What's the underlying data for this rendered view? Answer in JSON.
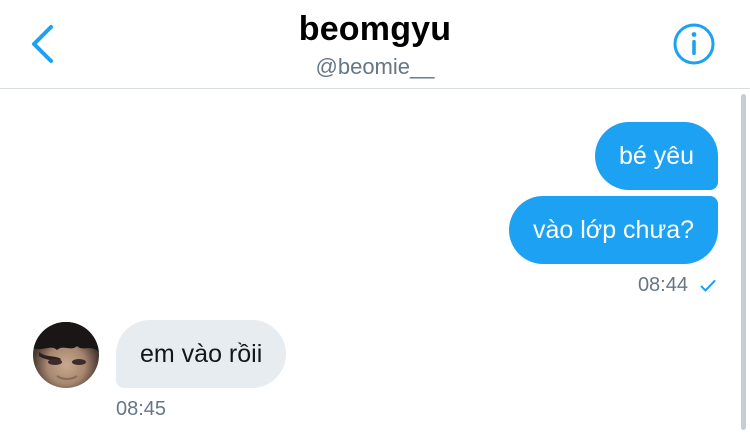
{
  "header": {
    "title": "beomgyu",
    "handle": "@beomie__",
    "back_icon": "chevron-left-icon",
    "info_icon": "info-circle-icon",
    "accent": "#1da1f2"
  },
  "messages": [
    {
      "direction": "outgoing",
      "text": "bé yêu"
    },
    {
      "direction": "outgoing",
      "text": "vào lớp chưa?"
    },
    {
      "direction": "incoming",
      "text": "em vào rồii"
    }
  ],
  "outgoing_meta": {
    "time": "08:44",
    "status_icon": "checkmark-icon"
  },
  "incoming_meta": {
    "time": "08:45"
  },
  "colors": {
    "outgoing_bubble": "#1da1f2",
    "incoming_bubble": "#e6ecf0",
    "meta_text": "#657786"
  }
}
